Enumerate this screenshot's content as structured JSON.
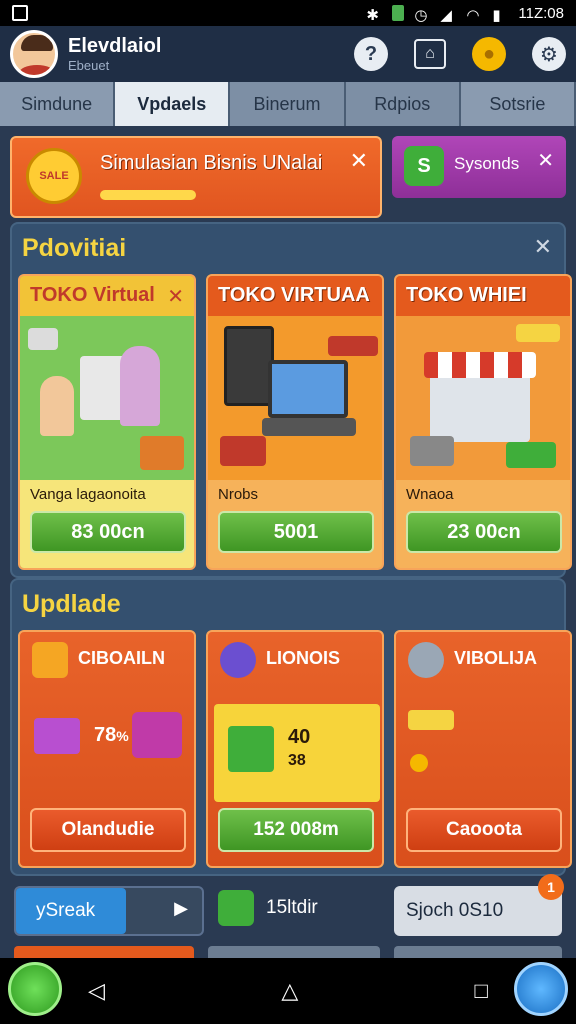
{
  "status_bar": {
    "time": "11Z:08"
  },
  "header": {
    "app_title": "Elevdlaiol",
    "app_subtitle": "Ebeuet"
  },
  "tabs": [
    {
      "label": "Simdune"
    },
    {
      "label": "Vpdaels"
    },
    {
      "label": "Binerum"
    },
    {
      "label": "Rdpios"
    },
    {
      "label": "Sotsrie"
    }
  ],
  "banner": {
    "text": "Simulasian Bisnis UNalai",
    "badge_text": "SALE"
  },
  "side_banner": {
    "text": "Sysonds",
    "icon_text": "S"
  },
  "section_toko": {
    "title": "Pdovitiai",
    "cards": [
      {
        "title": "TOKO Virtual",
        "label": "Vanga lagaonoita",
        "button": "83 00cn"
      },
      {
        "title": "TOKO VIRTUAA",
        "label": "Nrobs",
        "button": "5001"
      },
      {
        "title": "TOKO WHIEI",
        "label": "Wnaoa",
        "button": "23 00cn"
      }
    ]
  },
  "section_update": {
    "title": "Updlade",
    "cards": [
      {
        "title": "CIBOAILN",
        "value": "78",
        "unit": "%",
        "button": "Olandudie"
      },
      {
        "title": "LIONOIS",
        "value": "40",
        "value2": "38",
        "button": "152 008m"
      },
      {
        "title": "VIBOLIJA",
        "button": "Caooota"
      }
    ]
  },
  "bottom_bar": {
    "speak_label": "ySreak",
    "mid_label": "15ltdir",
    "right_label": "Sjoch  0S10",
    "notification_count": "1"
  }
}
